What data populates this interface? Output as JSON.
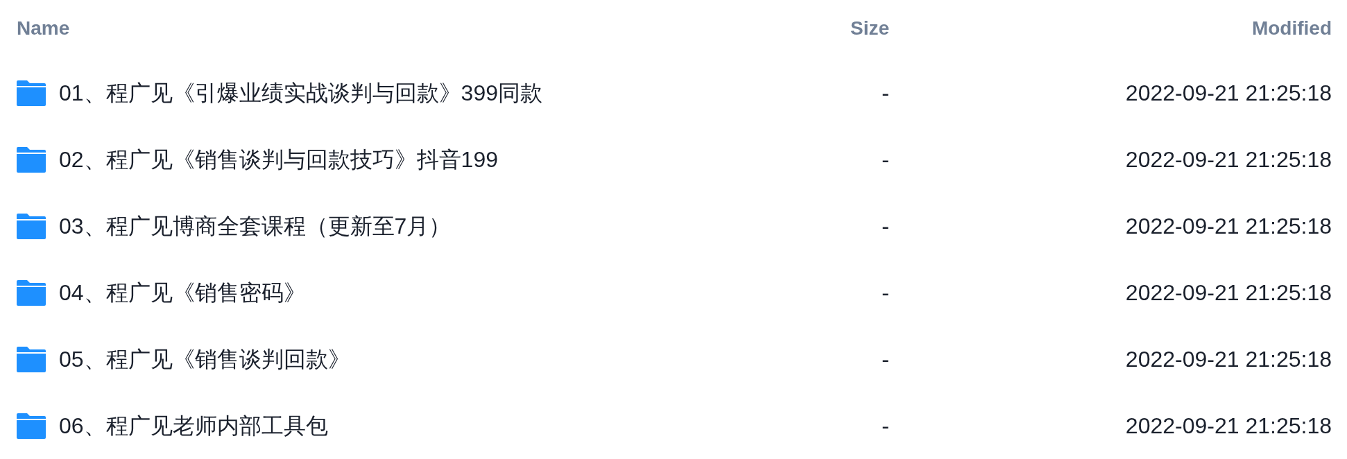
{
  "table": {
    "columns": [
      "Name",
      "Size",
      "Modified"
    ],
    "rows": [
      {
        "kind": "folder",
        "name": "01、程广见《引爆业绩实战谈判与回款》399同款",
        "size": "-",
        "modified": "2022-09-21 21:25:18"
      },
      {
        "kind": "folder",
        "name": "02、程广见《销售谈判与回款技巧》抖音199",
        "size": "-",
        "modified": "2022-09-21 21:25:18"
      },
      {
        "kind": "folder",
        "name": "03、程广见博商全套课程（更新至7月）",
        "size": "-",
        "modified": "2022-09-21 21:25:18"
      },
      {
        "kind": "folder",
        "name": "04、程广见《销售密码》",
        "size": "-",
        "modified": "2022-09-21 21:25:18"
      },
      {
        "kind": "folder",
        "name": "05、程广见《销售谈判回款》",
        "size": "-",
        "modified": "2022-09-21 21:25:18"
      },
      {
        "kind": "folder",
        "name": "06、程广见老师内部工具包",
        "size": "-",
        "modified": "2022-09-21 21:25:18"
      }
    ]
  }
}
